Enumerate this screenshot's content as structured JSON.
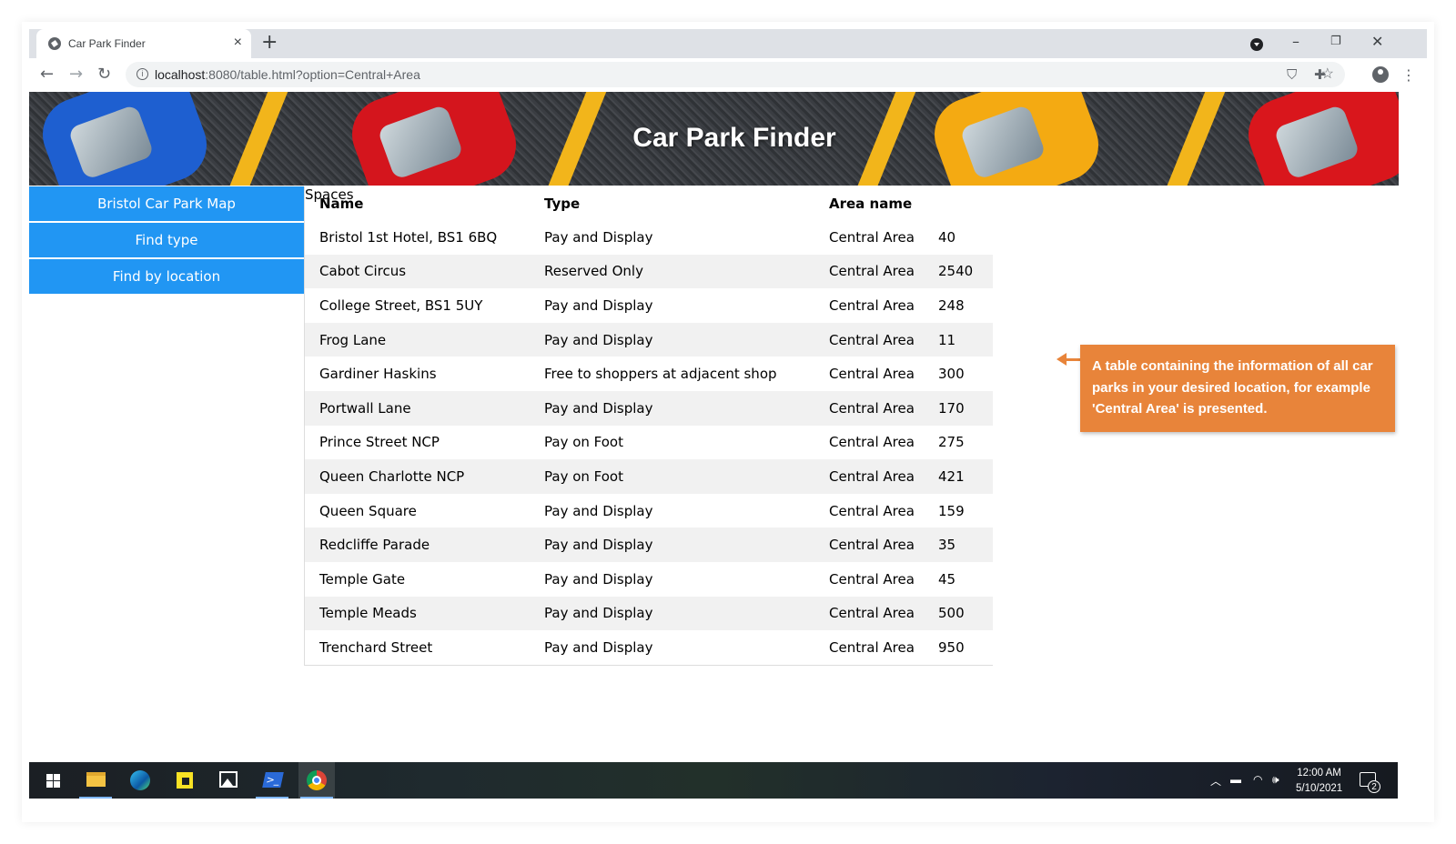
{
  "browser": {
    "tab_title": "Car Park Finder",
    "url_host": "localhost",
    "url_path": ":8080/table.html?option=Central+Area"
  },
  "page": {
    "banner_title": "Car Park Finder",
    "nav": [
      {
        "label": "Bristol Car Park Map"
      },
      {
        "label": "Find type"
      },
      {
        "label": "Find by location"
      }
    ],
    "table": {
      "headers": {
        "name": "Name",
        "type": "Type",
        "area": "Area name",
        "spaces": "Spaces"
      },
      "rows": [
        {
          "name": "Bristol 1st Hotel, BS1 6BQ",
          "type": "Pay and Display",
          "area": "Central Area",
          "spaces": "40"
        },
        {
          "name": "Cabot Circus",
          "type": "Reserved Only",
          "area": "Central Area",
          "spaces": "2540"
        },
        {
          "name": "College Street, BS1 5UY",
          "type": "Pay and Display",
          "area": "Central Area",
          "spaces": "248"
        },
        {
          "name": "Frog Lane",
          "type": "Pay and Display",
          "area": "Central Area",
          "spaces": "11"
        },
        {
          "name": "Gardiner Haskins",
          "type": "Free to shoppers at adjacent shop",
          "area": "Central Area",
          "spaces": "300"
        },
        {
          "name": "Portwall Lane",
          "type": "Pay and Display",
          "area": "Central Area",
          "spaces": "170"
        },
        {
          "name": "Prince Street NCP",
          "type": "Pay on Foot",
          "area": "Central Area",
          "spaces": "275"
        },
        {
          "name": "Queen Charlotte NCP",
          "type": "Pay on Foot",
          "area": "Central Area",
          "spaces": "421"
        },
        {
          "name": "Queen Square",
          "type": "Pay and Display",
          "area": "Central Area",
          "spaces": "159"
        },
        {
          "name": "Redcliffe Parade",
          "type": "Pay and Display",
          "area": "Central Area",
          "spaces": "35"
        },
        {
          "name": "Temple Gate",
          "type": "Pay and Display",
          "area": "Central Area",
          "spaces": "45"
        },
        {
          "name": "Temple Meads",
          "type": "Pay and Display",
          "area": "Central Area",
          "spaces": "500"
        },
        {
          "name": "Trenchard Street",
          "type": "Pay and Display",
          "area": "Central Area",
          "spaces": "950"
        }
      ]
    }
  },
  "callout": {
    "text": "A table containing the information of all car parks in your desired location, for example 'Central Area' is presented.",
    "color": "#e8843a"
  },
  "taskbar": {
    "time": "12:00 AM",
    "date": "5/10/2021",
    "notification_count": "2"
  },
  "colors": {
    "nav_button": "#2196f3",
    "row_stripe": "#f1f1f1",
    "banner_stripe": "#f2b51b"
  }
}
